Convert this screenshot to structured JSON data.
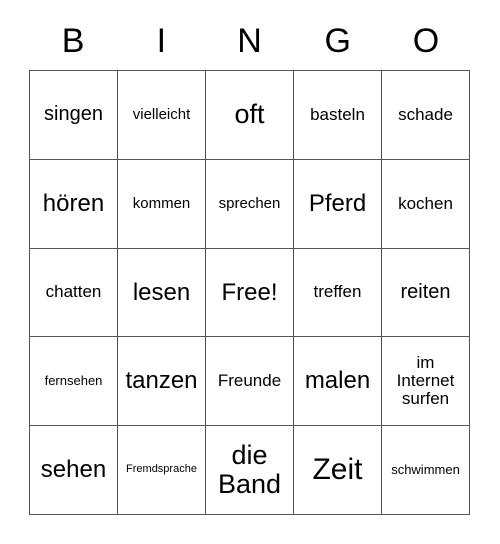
{
  "card": {
    "title": "BINGO",
    "header_letters": [
      "B",
      "I",
      "N",
      "G",
      "O"
    ],
    "free_space_label": "Free!",
    "rows": [
      [
        {
          "text": "singen",
          "size": "fs-l"
        },
        {
          "text": "vielleicht",
          "size": "fs-m"
        },
        {
          "text": "oft",
          "size": "fs-xxl"
        },
        {
          "text": "basteln",
          "size": "fs-ml"
        },
        {
          "text": "schade",
          "size": "fs-ml"
        }
      ],
      [
        {
          "text": "hören",
          "size": "fs-xl"
        },
        {
          "text": "kommen",
          "size": "fs-m"
        },
        {
          "text": "sprechen",
          "size": "fs-m"
        },
        {
          "text": "Pferd",
          "size": "fs-xl"
        },
        {
          "text": "kochen",
          "size": "fs-ml"
        }
      ],
      [
        {
          "text": "chatten",
          "size": "fs-ml"
        },
        {
          "text": "lesen",
          "size": "fs-xl"
        },
        {
          "text": "Free!",
          "size": "fs-xl"
        },
        {
          "text": "treffen",
          "size": "fs-ml"
        },
        {
          "text": "reiten",
          "size": "fs-l"
        }
      ],
      [
        {
          "text": "fernsehen",
          "size": "fs-s"
        },
        {
          "text": "tanzen",
          "size": "fs-xl"
        },
        {
          "text": "Freunde",
          "size": "fs-ml"
        },
        {
          "text": "malen",
          "size": "fs-xl"
        },
        {
          "text": "im\nInternet\nsurfen",
          "size": "fs-ml"
        }
      ],
      [
        {
          "text": "sehen",
          "size": "fs-xl"
        },
        {
          "text": "Fremdsprache",
          "size": "fs-xs"
        },
        {
          "text": "die\nBand",
          "size": "fs-xxl"
        },
        {
          "text": "Zeit",
          "size": "fs-huge"
        },
        {
          "text": "schwimmen",
          "size": "fs-s"
        }
      ]
    ]
  }
}
